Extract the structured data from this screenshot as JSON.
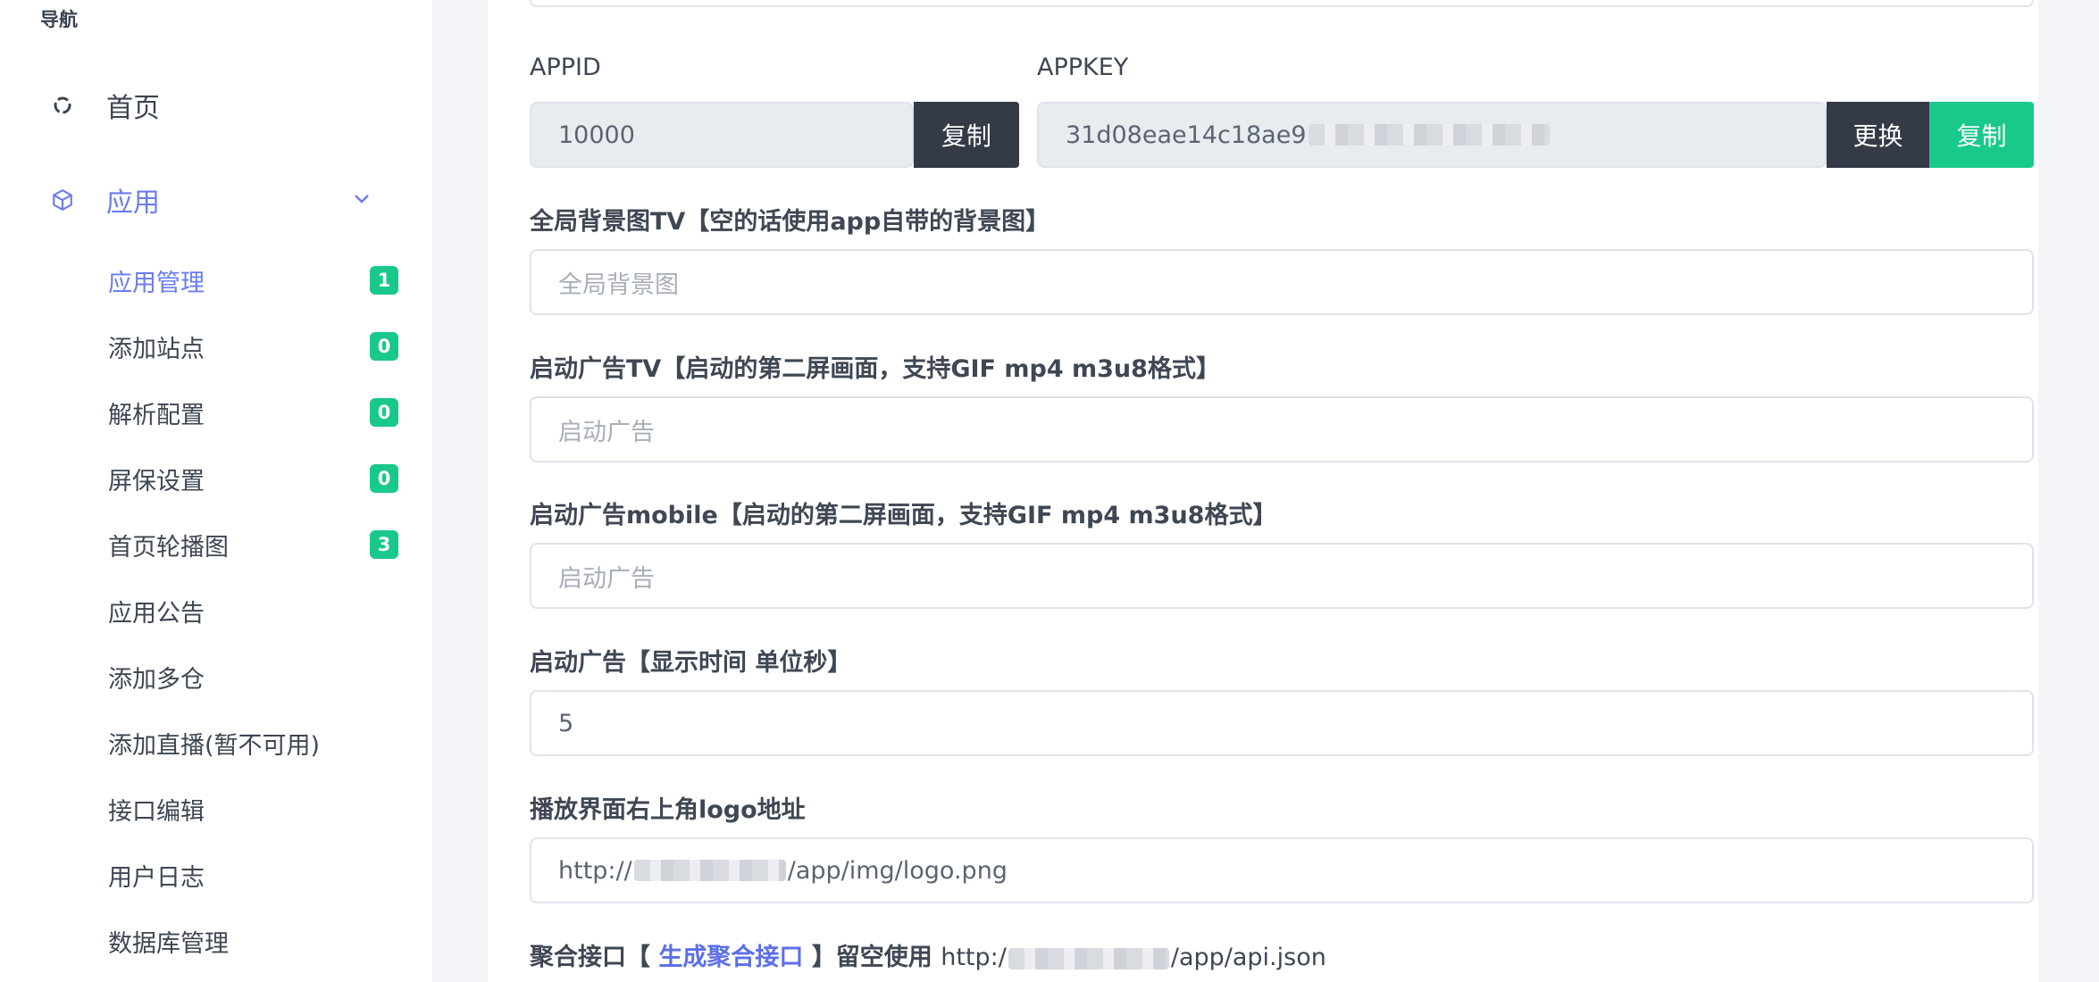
{
  "sidebar": {
    "title": "导航",
    "home": "首页",
    "app": "应用",
    "items": [
      {
        "label": "应用管理",
        "badge": "1"
      },
      {
        "label": "添加站点",
        "badge": "0"
      },
      {
        "label": "解析配置",
        "badge": "0"
      },
      {
        "label": "屏保设置",
        "badge": "0"
      },
      {
        "label": "首页轮播图",
        "badge": "3"
      },
      {
        "label": "应用公告"
      },
      {
        "label": "添加多仓"
      },
      {
        "label": "添加直播(暂不可用)"
      },
      {
        "label": "接口编辑"
      },
      {
        "label": "用户日志"
      },
      {
        "label": "数据库管理"
      }
    ]
  },
  "form": {
    "appid_label": "APPID",
    "appid_value": "10000",
    "appid_copy": "复制",
    "appkey_label": "APPKEY",
    "appkey_value": "31d08eae14c18ae9",
    "appkey_change": "更换",
    "appkey_copy": "复制",
    "bg_label": "全局背景图TV【空的话使用app自带的背景图】",
    "bg_placeholder": "全局背景图",
    "ad_tv_label": "启动广告TV【启动的第二屏画面，支持GIF mp4 m3u8格式】",
    "ad_tv_placeholder": "启动广告",
    "ad_mobile_label": "启动广告mobile【启动的第二屏画面，支持GIF mp4 m3u8格式】",
    "ad_mobile_placeholder": "启动广告",
    "ad_time_label": "启动广告【显示时间 单位秒】",
    "ad_time_value": "5",
    "logo_label": "播放界面右上角logo地址",
    "logo_prefix": "http://",
    "logo_suffix": "/app/img/logo.png",
    "agg_label_a": "聚合接口【",
    "agg_link": "生成聚合接口",
    "agg_label_b": "】留空使用",
    "agg_prefix": "http:/",
    "agg_suffix": "/app/api.json"
  }
}
